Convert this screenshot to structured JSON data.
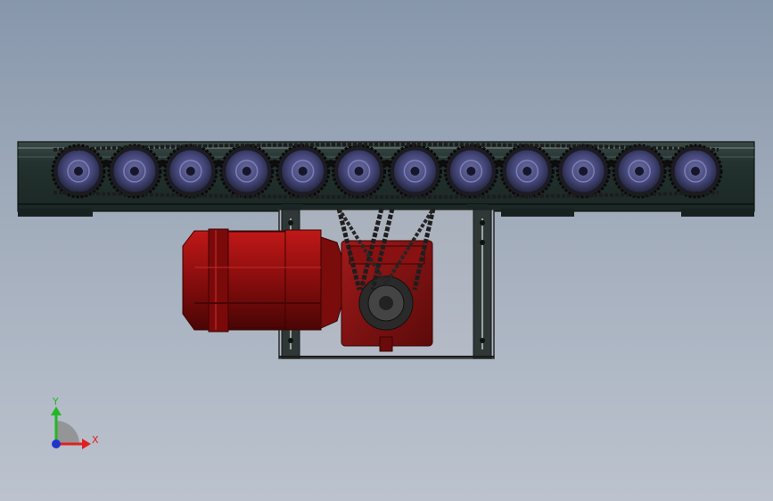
{
  "viewport": {
    "background_top": "#8797ab",
    "background_bottom": "#bcc3ce"
  },
  "model": {
    "frame_color": "#243530",
    "roller_color": "#3d3f6e",
    "chain_color": "#1c1c1c",
    "motor_color": "#8e0e0e",
    "gearbox_color": "#7a1414",
    "roller_count": 12
  },
  "triad": {
    "x_label": "X",
    "y_label": "Y",
    "x_color": "#e02020",
    "y_color": "#22b822",
    "z_color": "#2233cc"
  }
}
